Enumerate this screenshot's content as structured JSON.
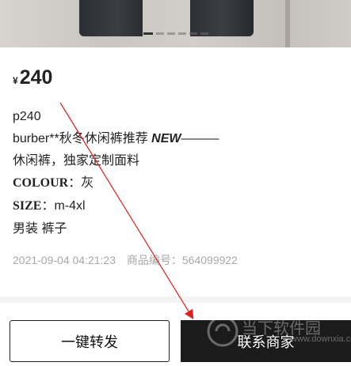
{
  "product": {
    "price_symbol": "¥",
    "price": "240",
    "lines": {
      "l1": "p240",
      "l2_prefix": " burber**秋冬休闲裤推荐 ",
      "l2_new": "NEW",
      "l2_suffix": "———",
      "l3": "休闲裤，独家定制面料",
      "colour_label": "COLOUR",
      "colour_value": "：灰",
      "size_label": "SIZE",
      "size_value": "：m-4xl",
      "l6": "男装 裤子"
    },
    "date": "2021-09-04 04:21:23",
    "code_label": "商品编号：",
    "code_value": "564099922"
  },
  "actions": {
    "share_label": "一键转发",
    "contact_label": "联系商家"
  },
  "watermark": {
    "text": "当下软件园",
    "url": "www.downxia.com"
  },
  "colors": {
    "contact_bg": "#1b1b1b",
    "arrow": "#e02020",
    "meta_text": "#a8a8a8"
  }
}
